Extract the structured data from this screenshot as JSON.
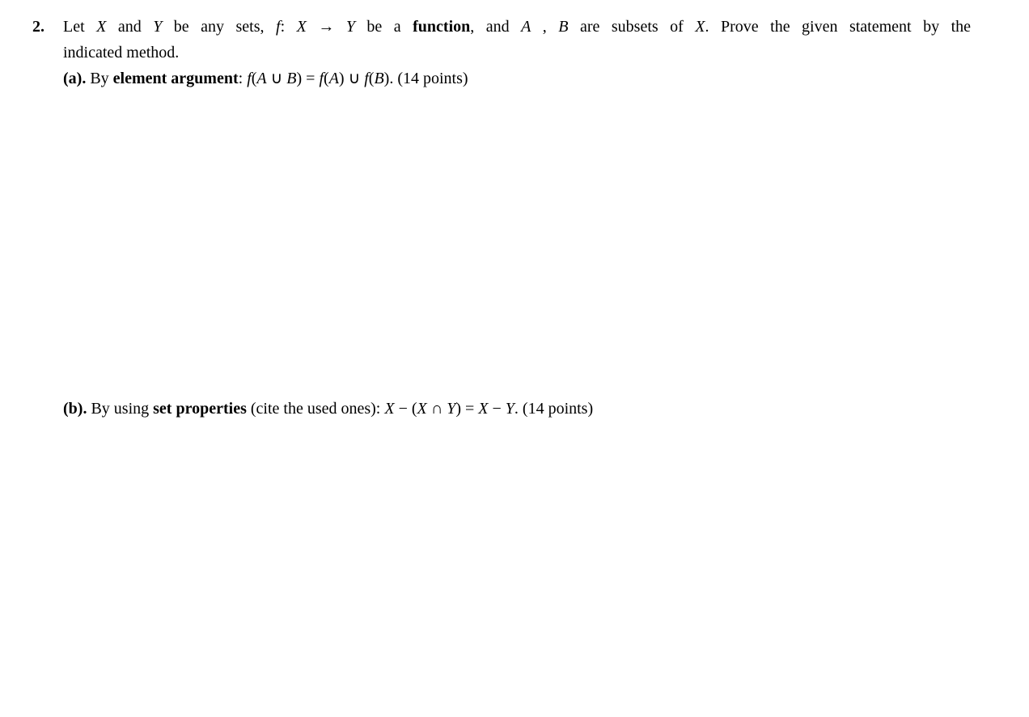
{
  "problem": {
    "number": "2.",
    "intro_part1_prefix": "Let ",
    "var_X": "X",
    "intro_and1": " and ",
    "var_Y": "Y",
    "intro_be_any_sets": " be any sets, ",
    "func_f": "f",
    "colon": ": ",
    "arrow": " → ",
    "intro_be_a": " be a ",
    "function_word": "function",
    "intro_comma_and": ", and  ",
    "var_A": "A",
    "intro_comma_sp": " ,  ",
    "var_B": "B",
    "intro_subsets": "  are subsets of ",
    "intro_prove": ". Prove the given statement by the",
    "intro_line2": "indicated method.",
    "part_a": {
      "label": "(a).",
      "by": " By ",
      "method": "element argument",
      "colon_sp": ": ",
      "eq_left_f": "f",
      "eq_left_paren_open": "(",
      "eq_left_A": "A",
      "eq_union1": " ∪ ",
      "eq_left_B": "B",
      "eq_left_paren_close": ")",
      "eq_equals": " = ",
      "eq_right_fA_f": "f",
      "eq_right_fA_open": "(",
      "eq_right_fA_A": "A",
      "eq_right_fA_close": ")",
      "eq_union2": " ∪ ",
      "eq_right_fB_f": "f",
      "eq_right_fB_open": "(",
      "eq_right_fB_B": "B",
      "eq_right_fB_close": ")",
      "period": ". ",
      "points": "(14 points)"
    },
    "part_b": {
      "label": "(b).",
      "by": " By using ",
      "method": "set properties",
      "cite": " (cite the used ones): ",
      "eq_X1": "X",
      "minus1": " − ",
      "paren_open": "(",
      "eq_X2": "X",
      "intersect": " ∩ ",
      "eq_Y1": "Y",
      "paren_close": ")",
      "eq_equals": " = ",
      "eq_X3": "X",
      "minus2": " − ",
      "eq_Y2": "Y",
      "period": ". ",
      "points": "(14 points)"
    }
  }
}
